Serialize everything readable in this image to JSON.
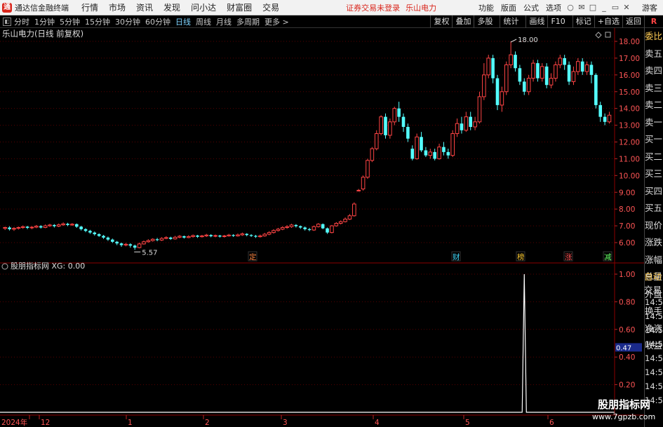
{
  "menubar": {
    "app_title": "通达信金融终端",
    "logo_glyph": "通",
    "items": [
      "行情",
      "市场",
      "资讯",
      "发现",
      "问小达",
      "财富圈",
      "交易"
    ],
    "notice": "证券交易未登录",
    "stock_name": "乐山电力",
    "right_items": [
      "功能",
      "版面",
      "公式",
      "选项"
    ],
    "guest": "游客",
    "window_icons": [
      "○",
      "✉",
      "□",
      "_",
      "▭",
      "✕"
    ]
  },
  "toolbar": {
    "ctrl_glyph": "◧",
    "periods": [
      "分时",
      "1分钟",
      "5分钟",
      "15分钟",
      "30分钟",
      "60分钟",
      "日线",
      "周线",
      "月线",
      "多周期",
      "更多 >"
    ],
    "active_period": "日线",
    "buttons": [
      "复权",
      "叠加",
      "多股",
      "统计",
      "画线",
      "F10",
      "标记",
      "+自选",
      "返回"
    ],
    "r_badge": "R"
  },
  "chart": {
    "title": "乐山电力(日线 前复权)",
    "high_label": "18.00",
    "low_label": "5.57",
    "y_ticks": [
      "18.00",
      "17.00",
      "16.00",
      "15.00",
      "14.00",
      "13.00",
      "12.00",
      "11.00",
      "10.00",
      "9.00",
      "8.00",
      "7.00",
      "6.00"
    ],
    "markers": [
      {
        "text": "定",
        "color": "#ff8844"
      },
      {
        "text": "财",
        "color": "#44ddff"
      },
      {
        "text": "榜",
        "color": "#ffcc33"
      },
      {
        "text": "涨",
        "color": "#ff5555"
      },
      {
        "text": "减",
        "color": "#66ff66"
      }
    ],
    "up_color": "#ff4444",
    "down_color": "#54ffff"
  },
  "indicator": {
    "title": "股朋指标网 XG: 0.00",
    "y_ticks": [
      "1.00",
      "0.80",
      "0.60",
      "0.40",
      "0.20"
    ],
    "current_value": "0.47"
  },
  "x_axis": [
    "2024年",
    "12",
    "1",
    "2",
    "3",
    "4",
    "5",
    "6"
  ],
  "side_panel": {
    "items": [
      "委比",
      "卖五",
      "卖四",
      "卖三",
      "卖二",
      "卖一",
      "买一",
      "买二",
      "买三",
      "买四",
      "买五",
      "现价",
      "涨跌",
      "涨幅",
      "总量",
      "外盘",
      "换手",
      "净资",
      "收益"
    ],
    "auto_trade": "自动",
    "trade": "交易",
    "times": [
      "14:56",
      "14:56",
      "14:56",
      "14:56",
      "14:56",
      "14:56",
      "14:56",
      "14:56"
    ]
  },
  "watermark": {
    "line1": "股朋指标网",
    "line2": "www.7gpzb.com"
  },
  "chart_data": {
    "type": "candlestick",
    "title": "乐山电力(日线 前复权)",
    "ylim": [
      5.3,
      18.6
    ],
    "candles": [
      [
        6.85,
        6.9,
        6.95,
        6.75
      ],
      [
        6.9,
        6.8,
        6.98,
        6.72
      ],
      [
        6.8,
        6.85,
        6.92,
        6.7
      ],
      [
        6.85,
        6.9,
        6.96,
        6.78
      ],
      [
        6.9,
        6.95,
        7.02,
        6.82
      ],
      [
        6.95,
        6.88,
        7.0,
        6.8
      ],
      [
        6.88,
        6.92,
        6.98,
        6.8
      ],
      [
        6.92,
        6.98,
        7.05,
        6.86
      ],
      [
        6.98,
        6.9,
        7.04,
        6.84
      ],
      [
        6.9,
        7.0,
        7.08,
        6.86
      ],
      [
        7.0,
        7.05,
        7.12,
        6.94
      ],
      [
        7.05,
        6.98,
        7.1,
        6.9
      ],
      [
        6.98,
        7.06,
        7.14,
        6.92
      ],
      [
        7.06,
        7.12,
        7.2,
        7.0
      ],
      [
        7.12,
        7.05,
        7.18,
        6.98
      ],
      [
        7.05,
        7.1,
        7.16,
        7.0
      ],
      [
        7.1,
        6.95,
        7.14,
        6.88
      ],
      [
        6.95,
        6.8,
        7.0,
        6.72
      ],
      [
        6.8,
        6.7,
        6.86,
        6.62
      ],
      [
        6.7,
        6.6,
        6.76,
        6.52
      ],
      [
        6.6,
        6.5,
        6.66,
        6.42
      ],
      [
        6.5,
        6.4,
        6.56,
        6.34
      ],
      [
        6.4,
        6.3,
        6.46,
        6.22
      ],
      [
        6.3,
        6.18,
        6.36,
        6.1
      ],
      [
        6.18,
        6.05,
        6.24,
        5.98
      ],
      [
        6.05,
        5.95,
        6.1,
        5.85
      ],
      [
        5.95,
        5.85,
        6.0,
        5.75
      ],
      [
        5.85,
        5.9,
        5.98,
        5.78
      ],
      [
        5.9,
        5.82,
        5.96,
        5.7
      ],
      [
        5.82,
        5.7,
        5.88,
        5.57
      ],
      [
        5.7,
        5.92,
        6.0,
        5.66
      ],
      [
        5.92,
        6.05,
        6.12,
        5.88
      ],
      [
        6.05,
        6.12,
        6.2,
        6.0
      ],
      [
        6.12,
        6.2,
        6.26,
        6.06
      ],
      [
        6.2,
        6.15,
        6.28,
        6.08
      ],
      [
        6.15,
        6.25,
        6.32,
        6.1
      ],
      [
        6.25,
        6.3,
        6.38,
        6.2
      ],
      [
        6.3,
        6.22,
        6.35,
        6.16
      ],
      [
        6.22,
        6.32,
        6.4,
        6.18
      ],
      [
        6.32,
        6.38,
        6.45,
        6.26
      ],
      [
        6.38,
        6.3,
        6.42,
        6.24
      ],
      [
        6.3,
        6.36,
        6.44,
        6.26
      ],
      [
        6.36,
        6.42,
        6.48,
        6.3
      ],
      [
        6.42,
        6.35,
        6.46,
        6.28
      ],
      [
        6.35,
        6.4,
        6.46,
        6.3
      ],
      [
        6.4,
        6.45,
        6.52,
        6.34
      ],
      [
        6.45,
        6.38,
        6.5,
        6.32
      ],
      [
        6.38,
        6.42,
        6.48,
        6.32
      ],
      [
        6.42,
        6.36,
        6.46,
        6.3
      ],
      [
        6.36,
        6.4,
        6.46,
        6.3
      ],
      [
        6.4,
        6.45,
        6.52,
        6.36
      ],
      [
        6.45,
        6.4,
        6.5,
        6.34
      ],
      [
        6.4,
        6.46,
        6.54,
        6.36
      ],
      [
        6.46,
        6.52,
        6.6,
        6.4
      ],
      [
        6.52,
        6.45,
        6.56,
        6.38
      ],
      [
        6.45,
        6.4,
        6.5,
        6.34
      ],
      [
        6.4,
        6.35,
        6.46,
        6.28
      ],
      [
        6.35,
        6.4,
        6.48,
        6.3
      ],
      [
        6.4,
        6.5,
        6.58,
        6.36
      ],
      [
        6.5,
        6.6,
        6.68,
        6.44
      ],
      [
        6.6,
        6.72,
        6.8,
        6.54
      ],
      [
        6.72,
        6.8,
        6.88,
        6.66
      ],
      [
        6.8,
        6.9,
        6.98,
        6.74
      ],
      [
        6.9,
        6.95,
        7.04,
        6.82
      ],
      [
        6.95,
        7.05,
        7.12,
        6.88
      ],
      [
        7.05,
        6.98,
        7.1,
        6.9
      ],
      [
        6.98,
        6.9,
        7.02,
        6.82
      ],
      [
        6.9,
        6.8,
        6.96,
        6.72
      ],
      [
        6.8,
        6.75,
        6.88,
        6.68
      ],
      [
        6.75,
        6.95,
        7.02,
        6.7
      ],
      [
        6.95,
        7.1,
        7.16,
        6.9
      ],
      [
        7.1,
        6.85,
        7.14,
        6.8
      ],
      [
        6.85,
        6.6,
        6.9,
        6.52
      ],
      [
        6.6,
        7.0,
        7.05,
        6.55
      ],
      [
        7.0,
        7.15,
        7.22,
        6.95
      ],
      [
        7.15,
        7.25,
        7.32,
        7.08
      ],
      [
        7.25,
        7.4,
        7.5,
        7.2
      ],
      [
        7.4,
        7.6,
        7.7,
        7.35
      ],
      [
        7.6,
        8.3,
        8.4,
        7.55
      ],
      [
        9.1,
        9.12,
        9.2,
        9.05
      ],
      [
        9.2,
        9.9,
        10.0,
        9.1
      ],
      [
        9.9,
        10.9,
        11.0,
        9.8
      ],
      [
        10.9,
        11.6,
        11.7,
        10.8
      ],
      [
        11.6,
        12.5,
        12.7,
        11.5
      ],
      [
        12.5,
        13.5,
        13.6,
        12.4
      ],
      [
        13.5,
        12.4,
        13.7,
        12.2
      ],
      [
        12.4,
        13.2,
        13.4,
        12.2
      ],
      [
        13.2,
        14.0,
        14.1,
        13.0
      ],
      [
        14.0,
        13.5,
        14.4,
        13.2
      ],
      [
        13.5,
        12.9,
        13.7,
        12.6
      ],
      [
        12.9,
        12.2,
        13.1,
        12.0
      ],
      [
        11.6,
        11.0,
        11.8,
        10.9
      ],
      [
        11.0,
        12.3,
        12.5,
        10.95
      ],
      [
        12.3,
        11.5,
        12.6,
        11.4
      ],
      [
        11.5,
        11.2,
        11.7,
        11.1
      ],
      [
        11.2,
        11.4,
        11.6,
        11.0
      ],
      [
        11.4,
        11.0,
        11.6,
        10.9
      ],
      [
        11.0,
        11.7,
        11.9,
        10.95
      ],
      [
        11.7,
        11.4,
        12.0,
        11.2
      ],
      [
        11.4,
        11.2,
        11.6,
        11.0
      ],
      [
        11.2,
        12.5,
        12.7,
        11.1
      ],
      [
        12.5,
        13.1,
        13.4,
        12.3
      ],
      [
        13.1,
        12.7,
        13.5,
        12.5
      ],
      [
        12.7,
        13.5,
        13.8,
        12.6
      ],
      [
        13.5,
        12.9,
        13.8,
        12.7
      ],
      [
        12.9,
        13.2,
        13.5,
        12.7
      ],
      [
        13.2,
        14.7,
        15.0,
        13.1
      ],
      [
        14.7,
        16.0,
        16.7,
        14.5
      ],
      [
        16.0,
        17.0,
        17.2,
        15.8
      ],
      [
        17.0,
        15.8,
        17.2,
        15.5
      ],
      [
        15.8,
        14.2,
        16.0,
        13.9
      ],
      [
        14.2,
        15.0,
        15.3,
        13.8
      ],
      [
        15.0,
        16.6,
        16.8,
        14.8
      ],
      [
        16.6,
        17.2,
        18.0,
        16.4
      ],
      [
        17.2,
        16.4,
        17.4,
        16.2
      ],
      [
        16.4,
        15.6,
        16.6,
        15.4
      ],
      [
        15.6,
        15.0,
        15.8,
        14.8
      ],
      [
        15.0,
        15.8,
        16.0,
        14.8
      ],
      [
        15.8,
        16.7,
        16.9,
        15.6
      ],
      [
        16.7,
        15.8,
        16.9,
        15.6
      ],
      [
        15.8,
        16.5,
        16.7,
        15.6
      ],
      [
        16.5,
        15.4,
        16.7,
        15.2
      ],
      [
        15.4,
        15.8,
        16.1,
        15.2
      ],
      [
        15.8,
        16.6,
        16.8,
        15.6
      ],
      [
        16.6,
        17.0,
        17.2,
        16.4
      ],
      [
        17.0,
        16.6,
        17.2,
        16.3
      ],
      [
        16.6,
        15.6,
        16.8,
        15.4
      ],
      [
        15.6,
        16.2,
        16.5,
        15.4
      ],
      [
        16.2,
        16.8,
        17.0,
        16.0
      ],
      [
        16.8,
        16.2,
        17.0,
        16.0
      ],
      [
        16.2,
        16.6,
        16.8,
        16.0
      ],
      [
        16.6,
        16.0,
        16.8,
        15.5
      ],
      [
        16.0,
        14.2,
        16.1,
        14.0
      ],
      [
        14.2,
        13.5,
        14.4,
        13.2
      ],
      [
        13.5,
        13.2,
        13.7,
        13.0
      ],
      [
        13.2,
        13.6,
        13.8,
        13.1
      ]
    ],
    "indicator_series": {
      "name": "XG",
      "spike_index": 116,
      "spike_value": 1.0,
      "baseline": 0.0
    }
  }
}
